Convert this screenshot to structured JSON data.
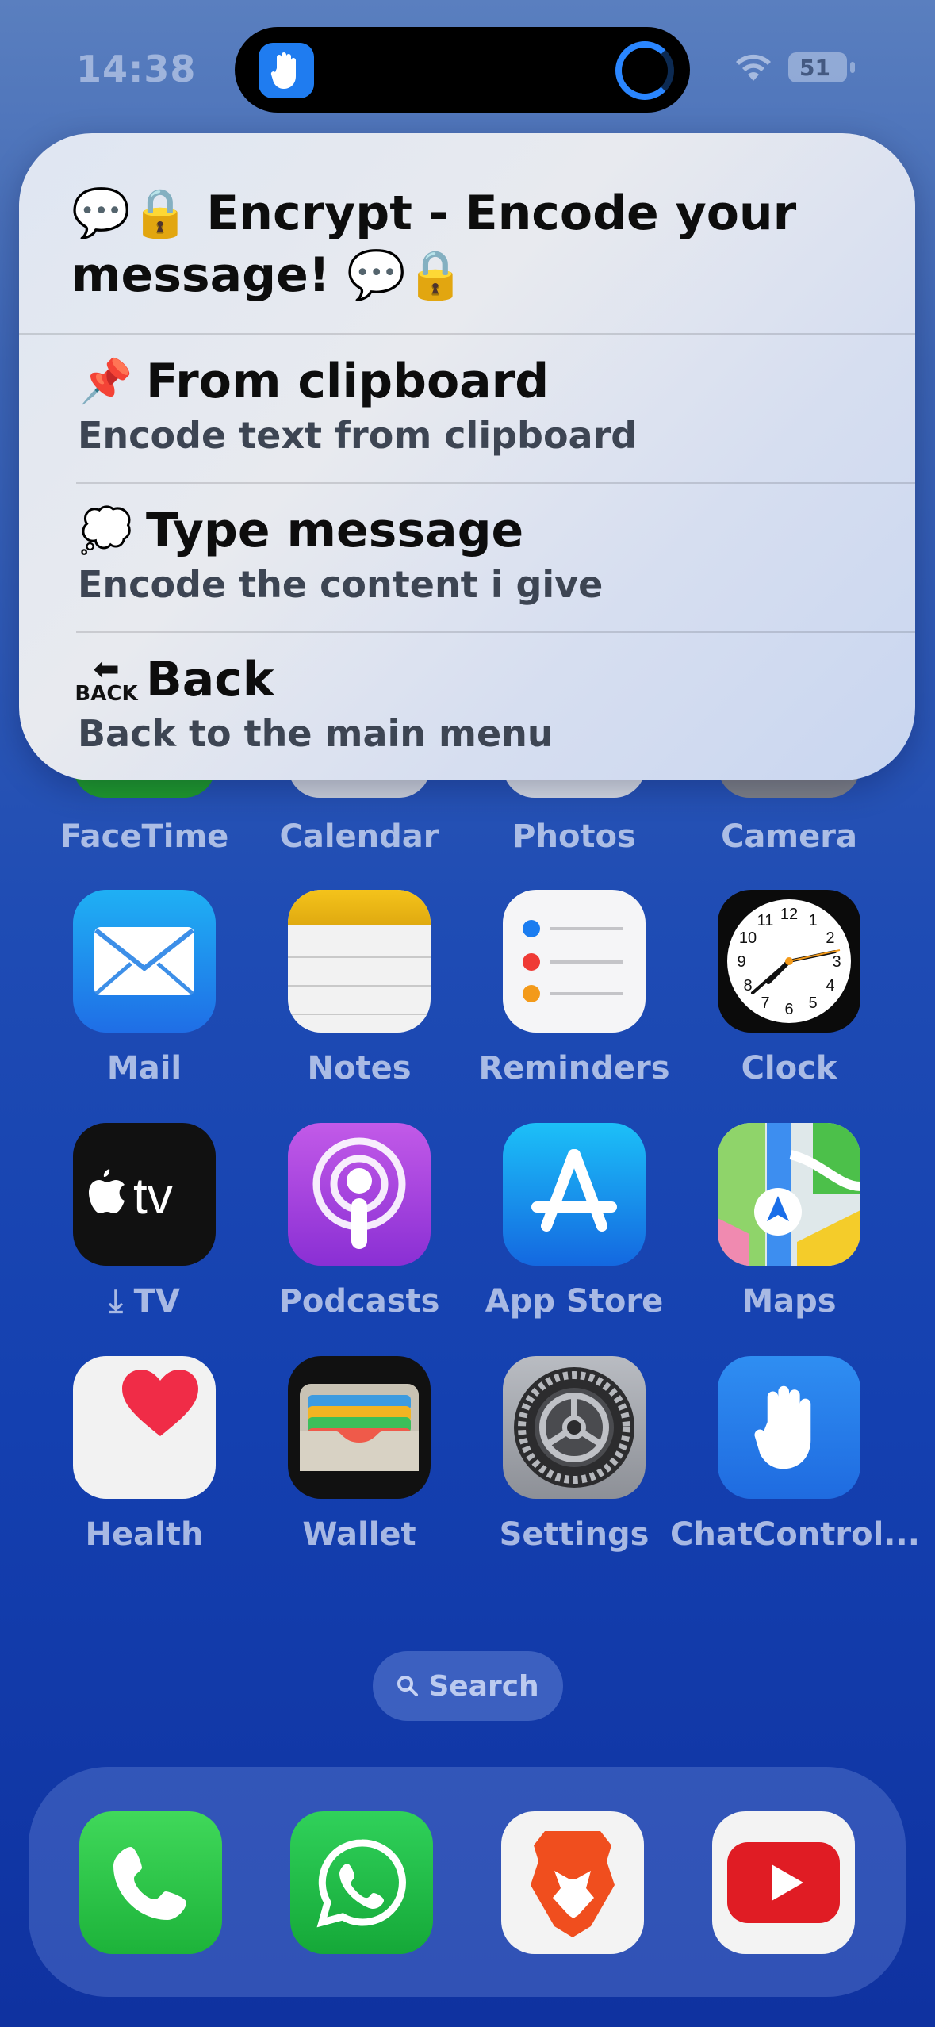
{
  "status_bar": {
    "time": "14:38",
    "battery": "51"
  },
  "menu": {
    "title": "💬🔒 Encrypt - Encode your message! 💬🔒",
    "items": [
      {
        "emoji": "📌",
        "label": "From clipboard",
        "subtitle": "Encode text from clipboard"
      },
      {
        "emoji": "💭",
        "label": "Type message",
        "subtitle": "Encode the content i give"
      },
      {
        "emoji_text": "BACK",
        "label": "Back",
        "subtitle": "Back to the main menu"
      }
    ]
  },
  "apps_row0": [
    "FaceTime",
    "Calendar",
    "Photos",
    "Camera"
  ],
  "apps": [
    {
      "name": "Mail"
    },
    {
      "name": "Notes"
    },
    {
      "name": "Reminders"
    },
    {
      "name": "Clock"
    },
    {
      "name": "TV"
    },
    {
      "name": "Podcasts"
    },
    {
      "name": "App Store"
    },
    {
      "name": "Maps"
    },
    {
      "name": "Health"
    },
    {
      "name": "Wallet"
    },
    {
      "name": "Settings"
    },
    {
      "name": "ChatControl..."
    }
  ],
  "search": {
    "label": "Search"
  },
  "clock_numbers": [
    "12",
    "1",
    "2",
    "3",
    "4",
    "5",
    "6",
    "7",
    "8",
    "9",
    "10",
    "11"
  ],
  "tv_text": "tv",
  "colors": {
    "accent": "#1f7cf0",
    "green": "#2bbf3c",
    "youtube": "#e01c24",
    "brave": "#f04e1e"
  }
}
